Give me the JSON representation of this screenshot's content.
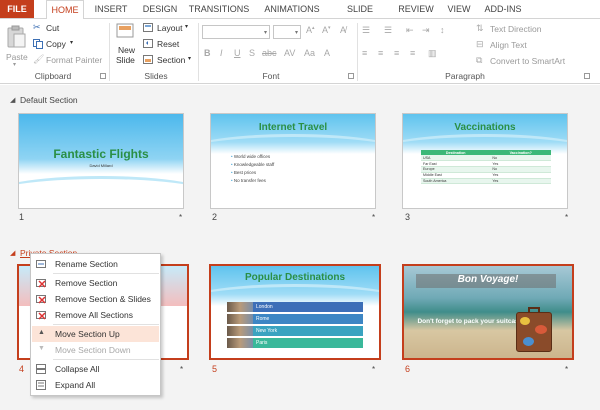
{
  "tabs": {
    "file": "FILE",
    "items": [
      "HOME",
      "INSERT",
      "DESIGN",
      "TRANSITIONS",
      "ANIMATIONS",
      "SLIDE SHOW",
      "REVIEW",
      "VIEW",
      "ADD-INS"
    ],
    "active": "HOME"
  },
  "ribbon": {
    "clipboard": {
      "paste": "Paste",
      "cut": "Cut",
      "copy": "Copy",
      "format_painter": "Format Painter",
      "label": "Clipboard"
    },
    "slides": {
      "new_slide_line1": "New",
      "new_slide_line2": "Slide",
      "layout": "Layout",
      "reset": "Reset",
      "section": "Section",
      "label": "Slides"
    },
    "font": {
      "label": "Font"
    },
    "paragraph": {
      "text_direction": "Text Direction",
      "align_text": "Align Text",
      "convert_smartart": "Convert to SmartArt",
      "label": "Paragraph"
    }
  },
  "sections": {
    "default": {
      "name": "Default Section"
    },
    "private": {
      "name": "Private Section"
    }
  },
  "slides": [
    {
      "number": "1",
      "title": "Fantastic Flights",
      "subtitle": "David Millard",
      "star": "*"
    },
    {
      "number": "2",
      "title": "Internet Travel",
      "bullets": [
        "World wide offices",
        "Knowledgeable staff",
        "Best prices",
        "No transfer fees"
      ],
      "star": "*"
    },
    {
      "number": "3",
      "title": "Vaccinations",
      "table": {
        "headers": [
          "Destination",
          "Vaccination?"
        ],
        "rows": [
          [
            "USA",
            "No"
          ],
          [
            "Far East",
            "Yes"
          ],
          [
            "Europe",
            "No"
          ],
          [
            "Middle East",
            "Yes"
          ],
          [
            "South America",
            "Yes"
          ]
        ]
      },
      "star": "*"
    },
    {
      "number": "4",
      "star": "*"
    },
    {
      "number": "5",
      "title": "Popular Destinations",
      "destinations": [
        "London",
        "Rome",
        "New York",
        "Paris"
      ],
      "star": "*"
    },
    {
      "number": "6",
      "title": "Bon Voyage!",
      "subtitle": "Don't forget to pack your suitcase!",
      "star": "*"
    }
  ],
  "context_menu": {
    "items": [
      {
        "label": "Rename Section",
        "icon": "rename-section-icon",
        "enabled": true
      },
      {
        "label": "Remove Section",
        "icon": "remove-section-icon",
        "enabled": true
      },
      {
        "label": "Remove Section & Slides",
        "icon": "remove-section-slides-icon",
        "enabled": true
      },
      {
        "label": "Remove All Sections",
        "icon": "remove-all-sections-icon",
        "enabled": true
      },
      {
        "label": "Move Section Up",
        "icon": "triangle-up-icon",
        "enabled": true,
        "highlighted": true
      },
      {
        "label": "Move Section Down",
        "icon": "triangle-down-icon",
        "enabled": false
      },
      {
        "label": "Collapse All",
        "icon": "collapse-all-icon",
        "enabled": true
      },
      {
        "label": "Expand All",
        "icon": "expand-all-icon",
        "enabled": true
      }
    ]
  },
  "colors": {
    "accent": "#c43e1c",
    "slide_title_green": "#2a8f45",
    "sky_blue": "#5fc3ee",
    "menu_highlight": "#fce4d8"
  }
}
